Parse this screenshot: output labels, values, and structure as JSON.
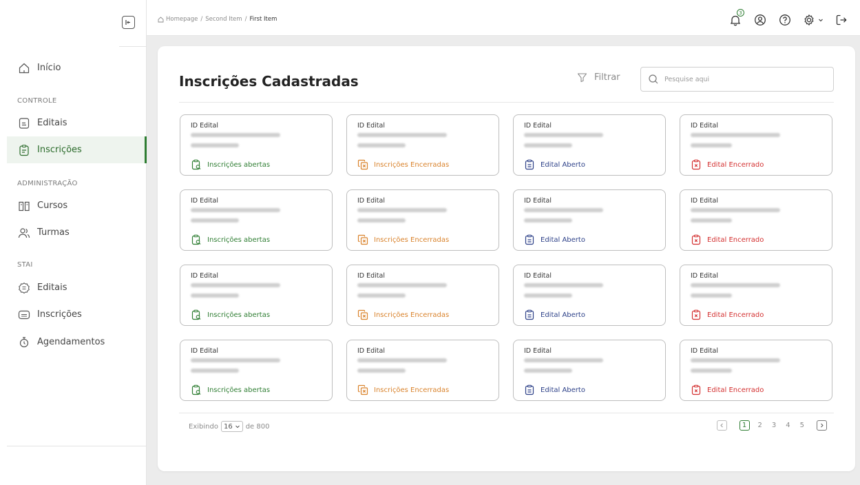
{
  "breadcrumb": {
    "home": "Homepage",
    "second": "Second Item",
    "current": "First Item",
    "sep": "/"
  },
  "header": {
    "notifications_count": "3"
  },
  "sidebar": {
    "home_label": "Início",
    "sections": [
      {
        "title": "CONTROLE",
        "items": [
          "Editais",
          "Inscrições"
        ]
      },
      {
        "title": "ADMINISTRAÇÃO",
        "items": [
          "Cursos",
          "Turmas"
        ]
      },
      {
        "title": "STAI",
        "items": [
          "Editais",
          "Inscrições",
          "Agendamentos"
        ]
      }
    ],
    "active_item": "Inscrições"
  },
  "main": {
    "title": "Inscrições Cadastradas",
    "filter_label": "Filtrar",
    "search_placeholder": "Pesquise aqui",
    "card_label": "ID Edital",
    "statuses": [
      {
        "label": "Inscrições abertas",
        "color": "#2e7d32",
        "icon": "clipboard-search-icon"
      },
      {
        "label": "Inscrições Encerradas",
        "color": "#d9822b",
        "icon": "copy-x-icon"
      },
      {
        "label": "Edital Aberto",
        "color": "#2b3f87",
        "icon": "clipboard-list-icon"
      },
      {
        "label": "Edital Encerrado",
        "color": "#d32f2f",
        "icon": "clipboard-x-icon"
      }
    ]
  },
  "footer": {
    "showing_prefix": "Exibindo",
    "per_page": "16",
    "total_prefix": "de",
    "total": "800",
    "pages": [
      "1",
      "2",
      "3",
      "4",
      "5"
    ],
    "current_page": "1"
  },
  "colors": {
    "accent": "#2e7d32",
    "background": "#ececec"
  }
}
